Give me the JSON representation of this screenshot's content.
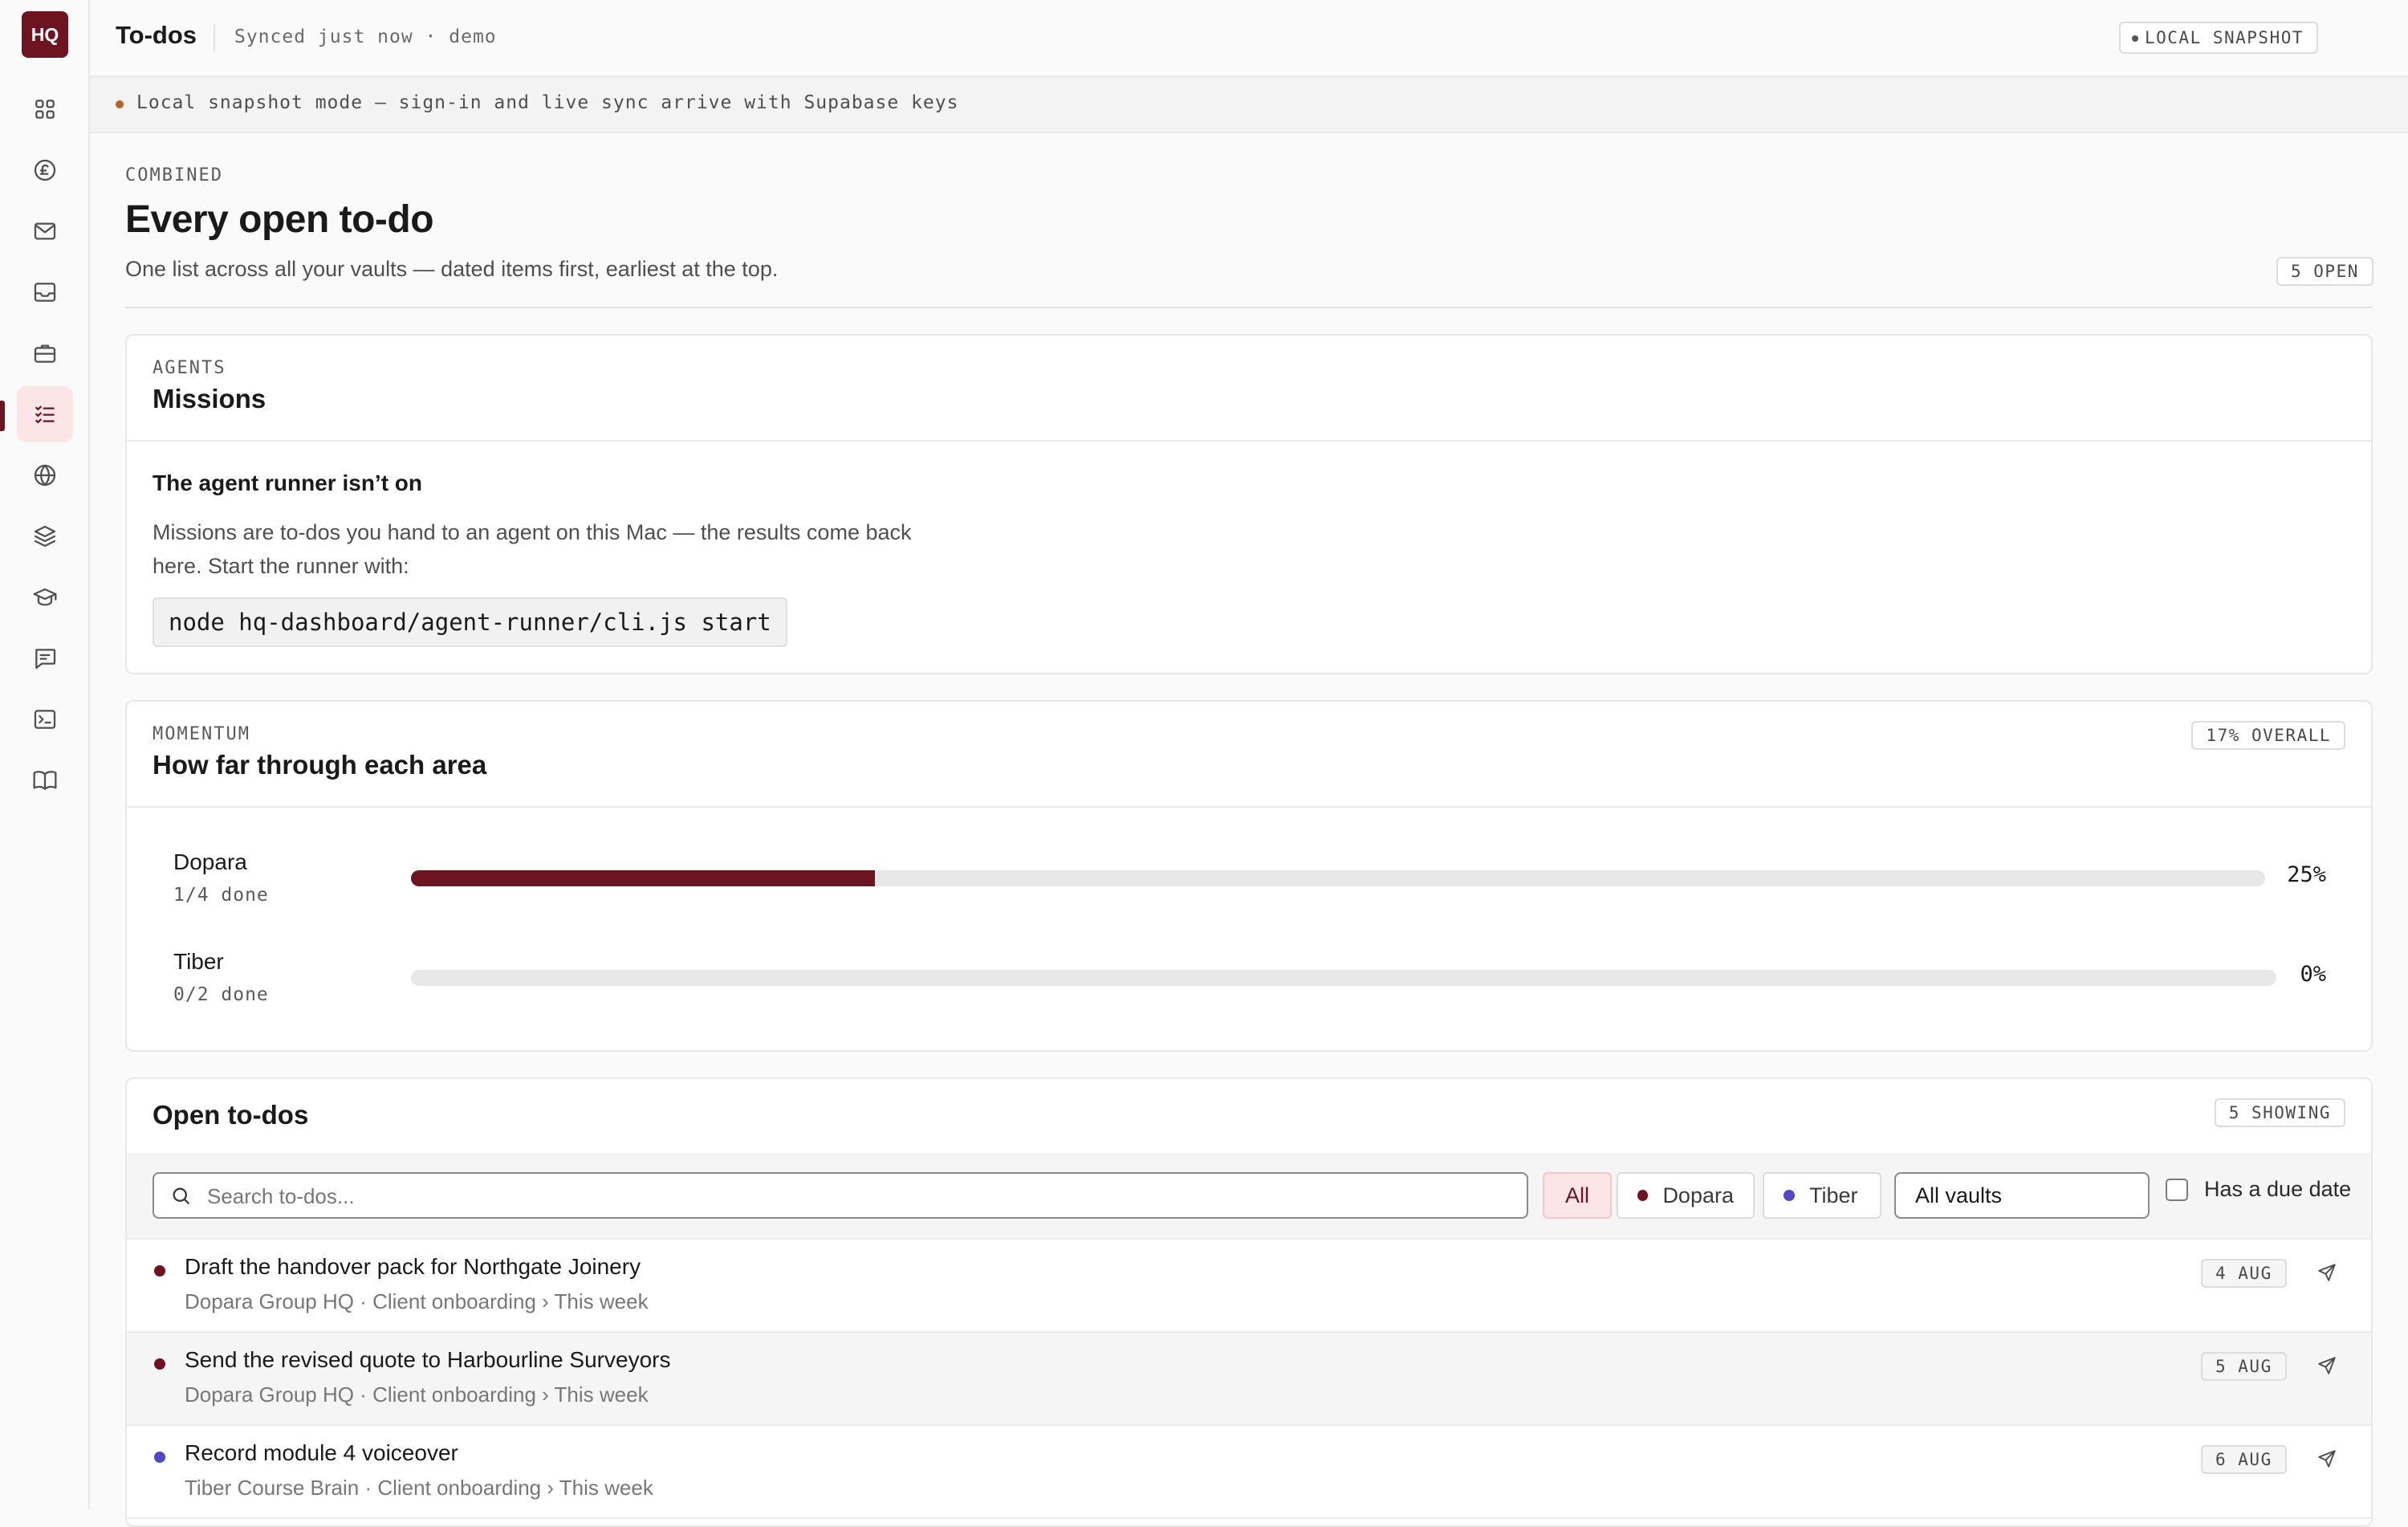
{
  "app": {
    "logo": "HQ"
  },
  "nav": {
    "items": [
      {
        "icon": "grid-icon"
      },
      {
        "icon": "currency-icon"
      },
      {
        "icon": "mail-icon"
      },
      {
        "icon": "inbox-icon"
      },
      {
        "icon": "briefcase-icon"
      },
      {
        "icon": "todo-list-icon",
        "active": true
      },
      {
        "icon": "globe-icon"
      },
      {
        "icon": "layers-icon"
      },
      {
        "icon": "graduation-cap-icon"
      },
      {
        "icon": "chat-icon"
      },
      {
        "icon": "terminal-icon"
      },
      {
        "icon": "book-icon"
      }
    ]
  },
  "header": {
    "title": "To-dos",
    "sync_status": "Synced just now · demo",
    "snapshot_badge": "LOCAL SNAPSHOT",
    "theme_icon": "moon-icon"
  },
  "banner": {
    "text": "Local snapshot mode — sign-in and live sync arrive with Supabase keys"
  },
  "page": {
    "eyebrow": "COMBINED",
    "title": "Every open to-do",
    "subtitle": "One list across all your vaults — dated items first, earliest at the top.",
    "open_count": "5 OPEN"
  },
  "missions": {
    "eyebrow": "AGENTS",
    "title": "Missions",
    "runner_title": "The agent runner isn’t on",
    "runner_desc": "Missions are to-dos you hand to an agent on this Mac — the results come back here. Start the runner with:",
    "command": "node hq-dashboard/agent-runner/cli.js start"
  },
  "momentum": {
    "eyebrow": "MOMENTUM",
    "title": "How far through each area",
    "overall": "17% OVERALL",
    "areas": [
      {
        "name": "Dopara",
        "done": "1/4 done",
        "percent_label": "25%",
        "progress": 0.25
      },
      {
        "name": "Tiber",
        "done": "0/2 done",
        "percent_label": "0%",
        "progress": 0
      }
    ]
  },
  "todos": {
    "title": "Open to-dos",
    "showing": "5 SHOWING",
    "search_placeholder": "Search to-dos...",
    "filters": {
      "all": "All",
      "dopara": "Dopara",
      "tiber": "Tiber"
    },
    "vault_select": "All vaults",
    "due_label": "Has a due date",
    "colors": {
      "dopara": "#6e1420",
      "tiber": "#4f46c8"
    },
    "items": [
      {
        "title": "Draft the handover pack for Northgate Joinery",
        "meta": "Dopara Group HQ · Client onboarding › This week",
        "date": "4 AUG",
        "vault": "dopara"
      },
      {
        "title": "Send the revised quote to Harbourline Surveyors",
        "meta": "Dopara Group HQ · Client onboarding › This week",
        "date": "5 AUG",
        "vault": "dopara"
      },
      {
        "title": "Record module 4 voiceover",
        "meta": "Tiber Course Brain · Client onboarding › This week",
        "date": "6 AUG",
        "vault": "tiber"
      }
    ]
  }
}
